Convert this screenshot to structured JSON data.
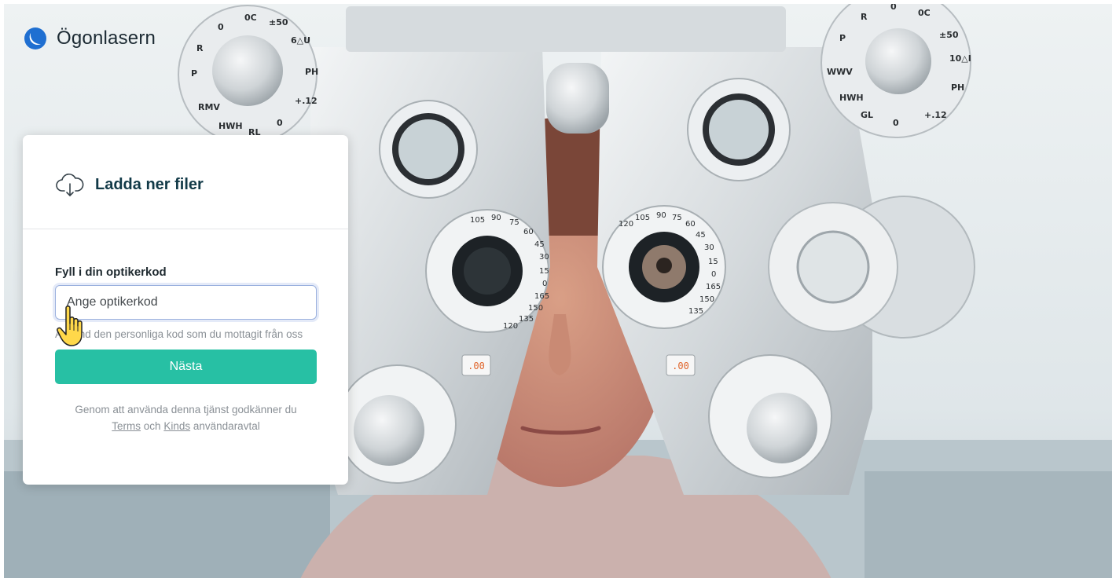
{
  "brand": {
    "name": "Ögonlasern",
    "logo_icon": "crescent-logo-icon",
    "accent": "#1f6fd1"
  },
  "card": {
    "header_icon": "cloud-download-icon",
    "title": "Ladda ner filer",
    "field_label": "Fyll i din optikerkod",
    "input_value": "",
    "input_placeholder": "Ange optikerkod",
    "help_text": "Använd den personliga kod som du mottagit från oss",
    "next_button": "Nästa",
    "button_color": "#27c0a4",
    "terms_before": "Genom att använda denna tjänst godkänner du",
    "terms_link": "Terms",
    "terms_middle": "och",
    "kinds_link": "Kinds",
    "terms_after": "användaravtal"
  },
  "cursor_icon": "hand-pointer-icon",
  "background": {
    "phoropter": {
      "left_scale": [
        "105",
        "90",
        "75",
        "60",
        "45",
        "30",
        "15",
        "0",
        "165",
        "150",
        "135",
        "120"
      ],
      "right_scale": [
        "120",
        "105",
        "90",
        "75",
        "60",
        "45",
        "30",
        "15",
        "0",
        "165",
        "150",
        "135"
      ],
      "left_readout": ".00",
      "right_readout": ".00",
      "top_left_dial": [
        "P",
        "R",
        "0",
        "0C",
        "±50",
        "6△U",
        "PH",
        "+.12",
        "0",
        "RL",
        "HWH",
        "RMV"
      ],
      "top_right_dial": [
        "P",
        "R",
        "0",
        "0C",
        "±50",
        "10△I",
        "PH",
        "+.12",
        "0",
        "GL",
        "HWH",
        "WWV"
      ]
    }
  }
}
